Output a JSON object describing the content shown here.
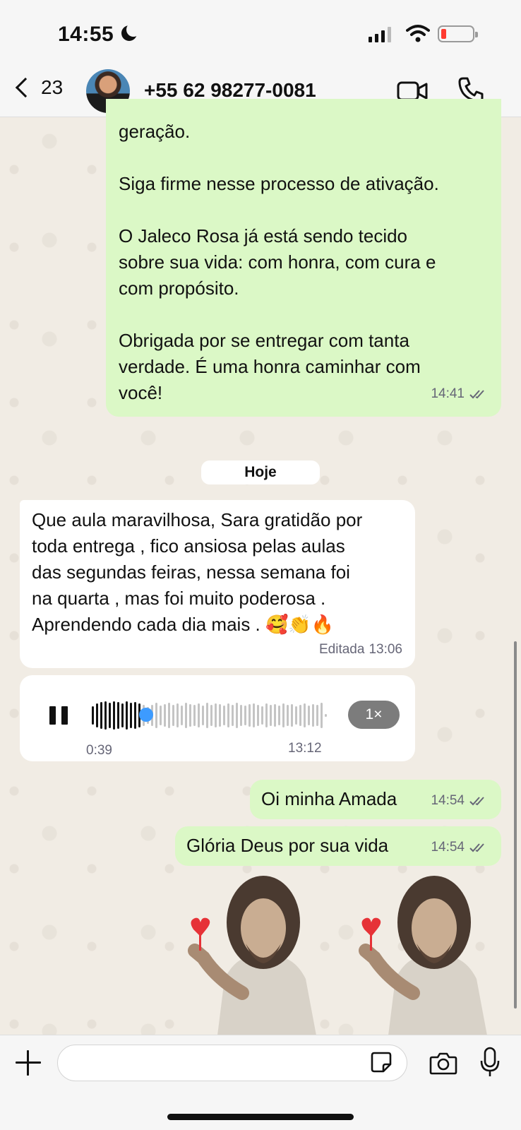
{
  "status_bar": {
    "time": "14:55"
  },
  "header": {
    "back_count": "23",
    "contact_name": "+55 62 98277-0081"
  },
  "messages": {
    "out_long": {
      "lines": [
        "geração.",
        "",
        "Siga firme nesse processo de ativação.",
        "",
        "O Jaleco Rosa já está sendo tecido",
        "sobre sua vida: com honra, com cura e",
        "com propósito.",
        "",
        "Obrigada por se entregar com tanta",
        "verdade. É uma honra caminhar com",
        "você!"
      ],
      "time": "14:41"
    },
    "date_divider": "Hoje",
    "in_text": {
      "lines": [
        "Que aula maravilhosa, Sara gratidão por",
        "toda entrega , fico ansiosa pelas aulas",
        "das segundas feiras, nessa semana foi",
        "na quarta , mas foi muito poderosa .",
        "Aprendendo cada dia mais . 🥰👏🔥"
      ],
      "edited_label": "Editada",
      "time": "13:06"
    },
    "in_audio": {
      "elapsed": "0:39",
      "time": "13:12",
      "speed": "1×",
      "progress": 0.22
    },
    "out_short_1": {
      "text": "Oi minha Amada",
      "time": "14:54"
    },
    "out_short_2": {
      "text": "Glória Deus por sua vida",
      "time": "14:54"
    }
  },
  "stickers": [
    "jesus-heart-sticker",
    "jesus-heart-sticker"
  ],
  "composer": {
    "placeholder": ""
  },
  "colors": {
    "outgoing": "#dbf8c6",
    "incoming": "#ffffff",
    "accent": "#3d9bff",
    "battery_low": "#ff3b30"
  }
}
